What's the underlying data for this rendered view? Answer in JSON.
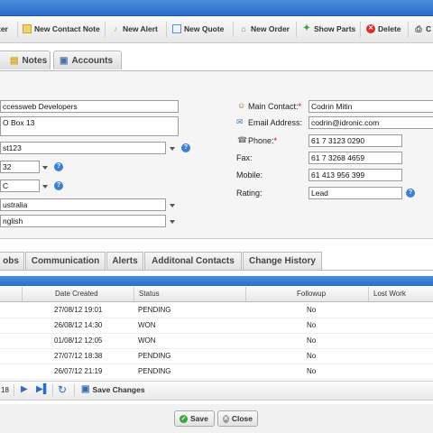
{
  "toolbar": {
    "items": [
      {
        "label": "ter",
        "icon": "contact-icon"
      },
      {
        "label": "New Contact Note",
        "icon": "note-icon"
      },
      {
        "label": "New Alert",
        "icon": "bell-icon"
      },
      {
        "label": "New Quote",
        "icon": "quote-icon"
      },
      {
        "label": "New Order",
        "icon": "cart-icon"
      },
      {
        "label": "Show Parts",
        "icon": "puzzle-icon"
      },
      {
        "label": "Delete",
        "icon": "delete-icon"
      },
      {
        "label": "C",
        "icon": "print-icon"
      }
    ]
  },
  "top_tabs": [
    {
      "label": "Notes",
      "icon": "folder-icon"
    },
    {
      "label": "Accounts",
      "icon": "book-icon"
    }
  ],
  "form_left": {
    "name": "ccessweb Developers",
    "address": "O Box 13",
    "field3": "st123",
    "field4": "32",
    "field5": "C",
    "country": "ustralia",
    "language": "nglish"
  },
  "form_right": {
    "main_contact_label": "Main Contact:",
    "main_contact": "Codrin Mitin",
    "email_label": "Email Address:",
    "email": "codrin@idronic.com",
    "phone_label": "Phone:",
    "phone": "61 7 3123 0290",
    "fax_label": "Fax:",
    "fax": "61 7 3268 4659",
    "mobile_label": "Mobile:",
    "mobile": "61 413 956 399",
    "rating_label": "Rating:",
    "rating": "Lead"
  },
  "bottom_tabs": [
    "obs",
    "Communication",
    "Alerts",
    "Additonal Contacts",
    "Change History"
  ],
  "grid": {
    "headers": {
      "date": "Date Created",
      "status": "Status",
      "followup": "Followup",
      "lost": "Lost Work"
    },
    "rows": [
      {
        "date": "27/08/12 19:01",
        "status": "PENDING",
        "followup": "No"
      },
      {
        "date": "26/08/12 14:30",
        "status": "WON",
        "followup": "No"
      },
      {
        "date": "01/08/12 12:05",
        "status": "WON",
        "followup": "No"
      },
      {
        "date": "27/07/12 18:38",
        "status": "PENDING",
        "followup": "No"
      },
      {
        "date": "26/07/12 21:19",
        "status": "PENDING",
        "followup": "No"
      }
    ]
  },
  "pager": {
    "page_fragment": "18",
    "save_changes": "Save Changes"
  },
  "footer": {
    "save": "Save",
    "close": "Close"
  },
  "colors": {
    "accent": "#2a6cc8",
    "required": "#d00000"
  }
}
